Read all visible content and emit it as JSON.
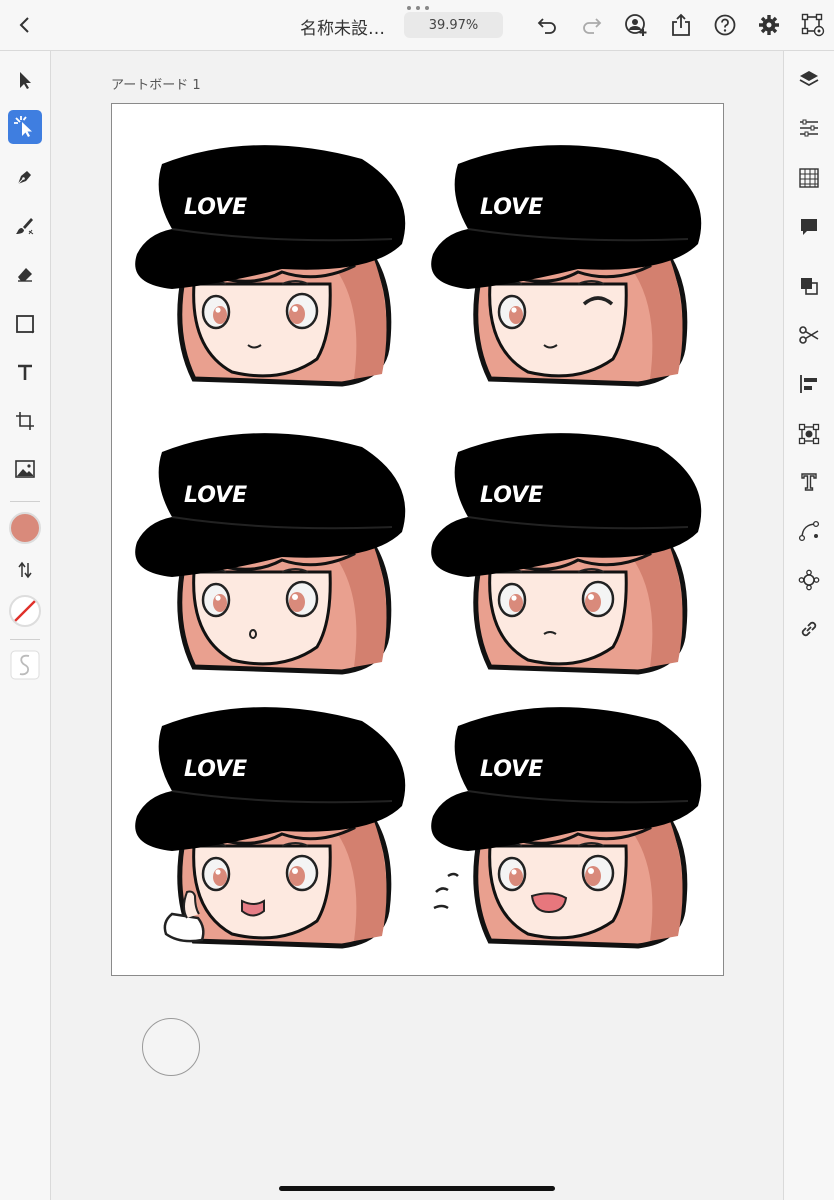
{
  "header": {
    "back_icon": "chevron-left-icon",
    "title": "名称未設…",
    "zoom": "39.97%",
    "actions": [
      "undo-icon",
      "redo-icon",
      "invite-user-icon",
      "share-icon",
      "help-icon",
      "settings-icon",
      "prototype-icon"
    ]
  },
  "tools": [
    "selection",
    "direct-selection",
    "pen",
    "brush",
    "eraser",
    "shape",
    "text",
    "crop",
    "image"
  ],
  "colors": {
    "fill": "#d98a7b",
    "accent": "#3f7ee0",
    "hair": "#e9a08f",
    "hair_shadow": "#d3806f",
    "skin": "#fde9e0"
  },
  "artboard": {
    "label": "アートボード 1",
    "stickers": [
      {
        "hat_text": "LOVE",
        "expression": "smile"
      },
      {
        "hat_text": "LOVE",
        "expression": "wink"
      },
      {
        "hat_text": "LOVE",
        "expression": "surprised"
      },
      {
        "hat_text": "LOVE",
        "expression": "neutral"
      },
      {
        "hat_text": "LOVE",
        "expression": "tongue-out"
      },
      {
        "hat_text": "LOVE",
        "expression": "shout"
      }
    ]
  },
  "right_panel": [
    "layers-icon",
    "properties-icon",
    "grid-icon",
    "comment-icon",
    "combine-icon",
    "scissors-icon",
    "align-icon",
    "transform-icon",
    "type-icon",
    "path-icon",
    "repeat-icon",
    "link-icon"
  ]
}
